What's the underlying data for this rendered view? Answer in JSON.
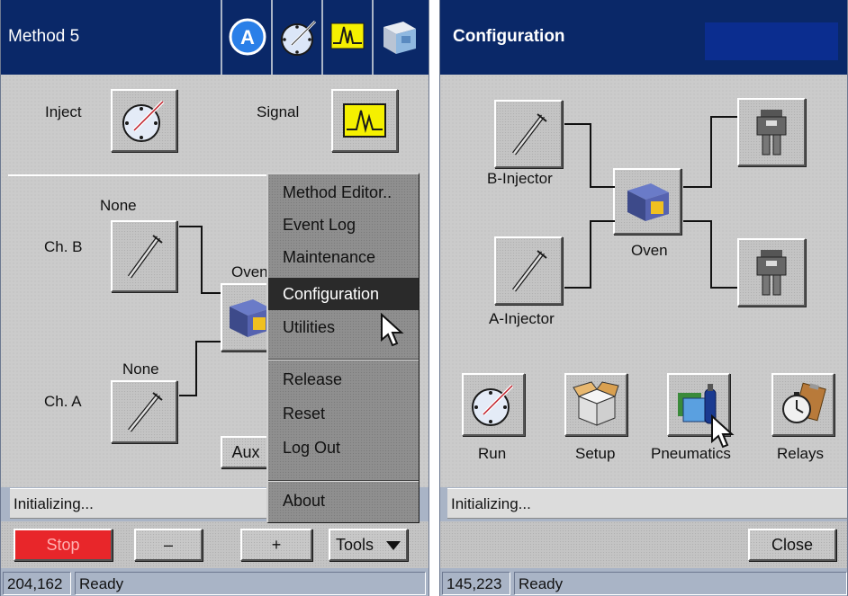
{
  "left_screen": {
    "title": "Method 5",
    "tabs": [
      {
        "icon": "a-circle-icon"
      },
      {
        "icon": "injector-dial-icon"
      },
      {
        "icon": "signal-peak-icon"
      },
      {
        "icon": "instrument-box-icon"
      }
    ],
    "inject_label": "Inject",
    "signal_label": "Signal",
    "ch_b_label": "Ch. B",
    "ch_b_value": "None",
    "ch_a_label": "Ch. A",
    "ch_a_value": "None",
    "oven_label": "Oven",
    "aux_label": "Aux",
    "status_text": "Initializing...",
    "buttons": {
      "stop": "Stop",
      "minus": "–",
      "plus": "+",
      "tools": "Tools"
    },
    "menu": {
      "items": [
        "Method Editor..",
        "Event Log",
        "Maintenance",
        "Configuration",
        "Utilities"
      ],
      "items2": [
        "Release",
        "Reset",
        "Log Out"
      ],
      "items3": [
        "About"
      ],
      "selected": "Configuration"
    },
    "coords": "204,162",
    "ready": "Ready"
  },
  "right_screen": {
    "title": "Configuration",
    "b_injector_label": "B-Injector",
    "a_injector_label": "A-Injector",
    "oven_label": "Oven",
    "run_label": "Run",
    "setup_label": "Setup",
    "pneumatics_label": "Pneumatics",
    "relays_label": "Relays",
    "status_text": "Initializing...",
    "close_label": "Close",
    "coords": "145,223",
    "ready": "Ready"
  },
  "colors": {
    "title_bg": "#0a2868",
    "stop_red": "#e8262a",
    "signal_yellow": "#f5f000",
    "window_frame": "#a9b4c6"
  }
}
